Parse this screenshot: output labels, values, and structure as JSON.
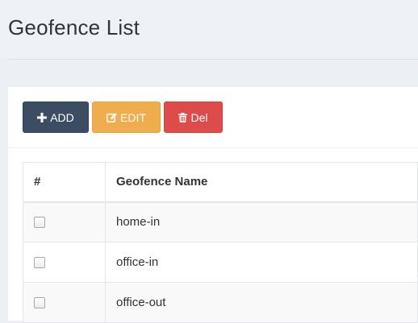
{
  "page": {
    "title": "Geofence List"
  },
  "toolbar": {
    "add_label": "ADD",
    "add_icon": "plus-icon",
    "edit_label": "EDIT",
    "edit_icon": "edit-icon",
    "del_label": "Del",
    "del_icon": "trash-icon"
  },
  "colors": {
    "add": "#3c4c63",
    "edit": "#f0ad4e",
    "del": "#dd4b4b"
  },
  "table": {
    "headers": [
      "#",
      "Geofence Name"
    ],
    "rows": [
      {
        "checked": false,
        "name": "home-in"
      },
      {
        "checked": false,
        "name": "office-in"
      },
      {
        "checked": false,
        "name": "office-out"
      }
    ]
  }
}
